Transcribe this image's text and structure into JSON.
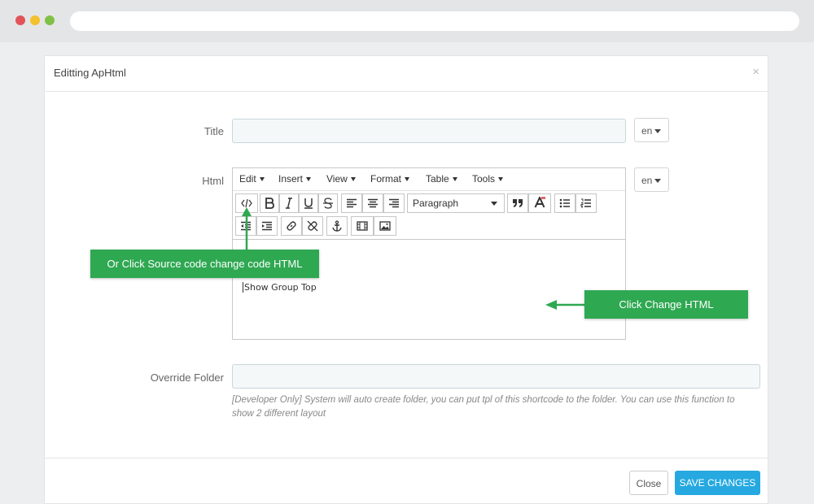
{
  "modal": {
    "title": "Editting ApHtml",
    "close_glyph": "×"
  },
  "form": {
    "title_label": "Title",
    "title_value": "",
    "html_label": "Html",
    "override_label": "Override Folder",
    "override_value": "",
    "help_text": "[Developer Only] System will auto create folder, you can put tpl of this shortcode to the folder. You can use this function to show 2 different layout",
    "lang_title": "en",
    "lang_html": "en"
  },
  "editor": {
    "menu": [
      "Edit",
      "Insert",
      "View",
      "Format",
      "Table",
      "Tools"
    ],
    "block_format": "Paragraph",
    "content": "Show Group Top"
  },
  "footer": {
    "close_label": "Close",
    "save_label": "SAVE CHANGES"
  },
  "annotations": {
    "source_code_callout": "Or Click Source code change code HTML",
    "change_html_callout": "Click Change HTML",
    "color": "#2fa852"
  },
  "colors": {
    "primary_button": "#25a9e0"
  }
}
